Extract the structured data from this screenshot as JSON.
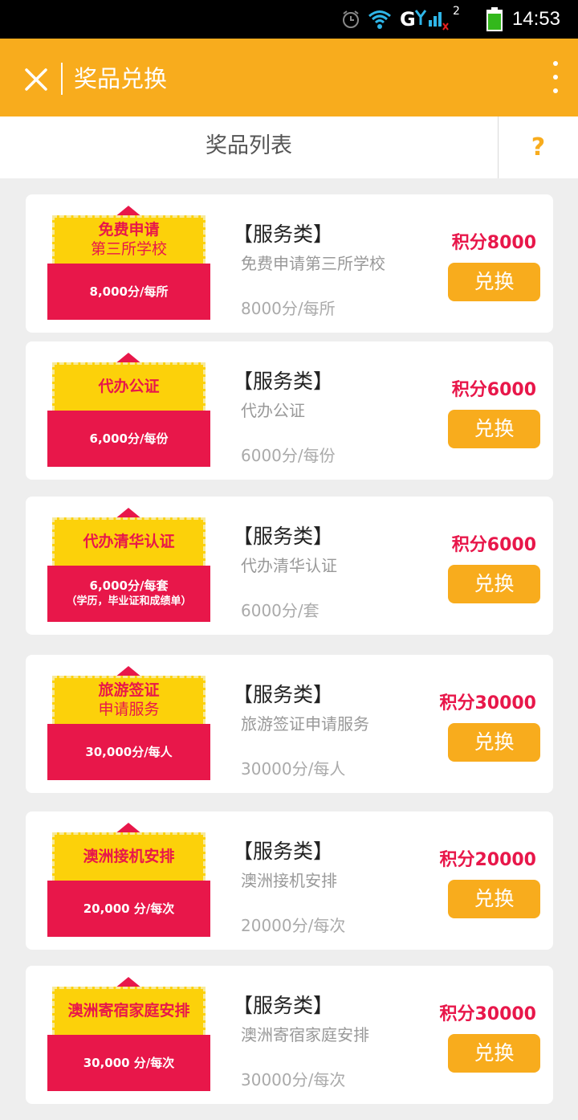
{
  "status_bar": {
    "time": "14:53",
    "network": "G",
    "sim": "2"
  },
  "app_bar": {
    "title": "奖品兑换"
  },
  "sub_header": {
    "title": "奖品列表",
    "help": "?"
  },
  "items": [
    {
      "ticket_line1": "免费申请",
      "ticket_line2": "第三所学校",
      "ticket_price": "8,000分/每所",
      "ticket_note": "",
      "category": "【服务类】",
      "name": "免费申请第三所学校",
      "price": "8000分/每所",
      "points": "积分8000",
      "button": "兑换"
    },
    {
      "ticket_line1": "代办公证",
      "ticket_line2": "",
      "ticket_price": "6,000分/每份",
      "ticket_note": "",
      "category": "【服务类】",
      "name": "代办公证",
      "price": "6000分/每份",
      "points": "积分6000",
      "button": "兑换"
    },
    {
      "ticket_line1": "代办清华认证",
      "ticket_line2": "",
      "ticket_price": "6,000分/每套",
      "ticket_note": "（学历，毕业证和成绩单）",
      "category": "【服务类】",
      "name": "代办清华认证",
      "price": "6000分/套",
      "points": "积分6000",
      "button": "兑换"
    },
    {
      "ticket_line1": "旅游签证",
      "ticket_line2": "申请服务",
      "ticket_price": "30,000分/每人",
      "ticket_note": "",
      "category": "【服务类】",
      "name": "旅游签证申请服务",
      "price": "30000分/每人",
      "points": "积分30000",
      "button": "兑换"
    },
    {
      "ticket_line1": "澳洲接机安排",
      "ticket_line2": "",
      "ticket_price": "20,000 分/每次",
      "ticket_note": "",
      "category": "【服务类】",
      "name": "澳洲接机安排",
      "price": "20000分/每次",
      "points": "积分20000",
      "button": "兑换"
    },
    {
      "ticket_line1": "澳洲寄宿家庭安排",
      "ticket_line2": "",
      "ticket_price": "30,000 分/每次",
      "ticket_note": "",
      "category": "【服务类】",
      "name": "澳洲寄宿家庭安排",
      "price": "30000分/每次",
      "points": "积分30000",
      "button": "兑换"
    }
  ],
  "colors": {
    "accent": "#f8ac1d",
    "red": "#e8174a",
    "ticket_yellow": "#fcd10a",
    "background": "#eeeeee"
  }
}
